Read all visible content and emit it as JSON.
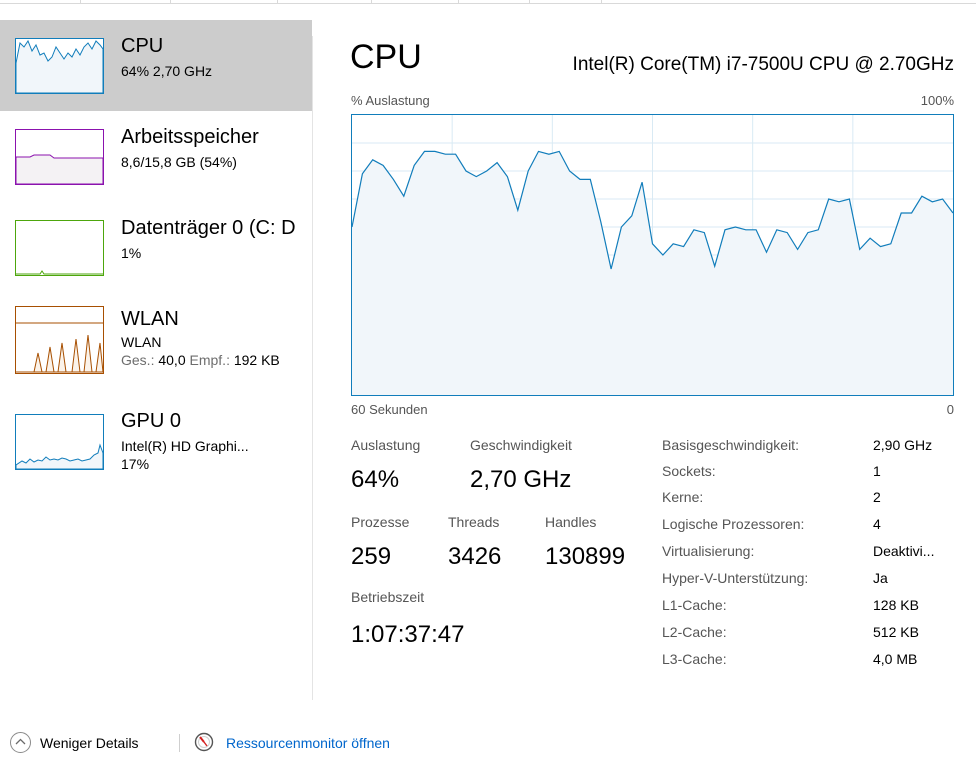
{
  "colors": {
    "cpu_accent": "#117dbb",
    "cpu_fill": "#f1f6fa",
    "memory_accent": "#8b12ae",
    "disk_accent": "#4da60c",
    "wlan_accent": "#a74f01",
    "gpu_accent": "#117dbb",
    "selected_bg": "#cccccc",
    "link": "#0066cc"
  },
  "sidebar": {
    "items": [
      {
        "title": "CPU",
        "sub1": "64% 2,70 GHz"
      },
      {
        "title": "Arbeitsspeicher",
        "sub1": "8,6/15,8 GB (54%)"
      },
      {
        "title": "Datenträger 0 (C: D",
        "sub1": "1%"
      },
      {
        "title": "WLAN",
        "sub1": "WLAN",
        "sub2_a": "Ges.: ",
        "sub2_b": "40,0",
        "sub2_c": " Empf.: ",
        "sub2_d": "192 KB"
      },
      {
        "title": "GPU 0",
        "sub1": "Intel(R) HD Graphi...",
        "sub2": "17%"
      }
    ]
  },
  "main": {
    "title": "CPU",
    "model": "Intel(R) Core(TM) i7-7500U CPU @ 2.70GHz",
    "graph": {
      "top_left": "% Auslastung",
      "top_right": "100%",
      "bottom_left": "60 Sekunden",
      "bottom_right": "0"
    },
    "stats": {
      "auslastung_label": "Auslastung",
      "auslastung_value": "64%",
      "geschw_label": "Geschwindigkeit",
      "geschw_value": "2,70 GHz",
      "prozesse_label": "Prozesse",
      "prozesse_value": "259",
      "threads_label": "Threads",
      "threads_value": "3426",
      "handles_label": "Handles",
      "handles_value": "130899",
      "betriebszeit_label": "Betriebszeit",
      "betriebszeit_value": "1:07:37:47"
    },
    "details": [
      {
        "label": "Basisgeschwindigkeit:",
        "value": "2,90 GHz"
      },
      {
        "label": "Sockets:",
        "value": "1"
      },
      {
        "label": "Kerne:",
        "value": "2"
      },
      {
        "label": "Logische Prozessoren:",
        "value": "4"
      },
      {
        "label": "Virtualisierung:",
        "value": "Deaktivi..."
      },
      {
        "label": "Hyper-V-Unterstützung:",
        "value": "Ja"
      },
      {
        "label": "L1-Cache:",
        "value": "128 KB"
      },
      {
        "label": "L2-Cache:",
        "value": "512 KB"
      },
      {
        "label": "L3-Cache:",
        "value": "4,0 MB"
      }
    ]
  },
  "chart_data": {
    "type": "area",
    "ylim": [
      0,
      100
    ],
    "values": [
      60,
      79,
      84,
      82,
      77,
      71,
      82,
      87,
      87,
      86,
      86,
      80,
      78,
      80,
      83,
      78,
      66,
      80,
      87,
      86,
      87,
      80,
      77,
      77,
      62,
      45,
      60,
      64,
      76,
      54,
      50,
      54,
      53,
      59,
      58,
      46,
      59,
      60,
      59,
      59,
      51,
      59,
      58,
      52,
      58,
      59,
      70,
      69,
      70,
      52,
      56,
      53,
      54,
      65,
      65,
      71,
      69,
      70,
      65
    ]
  },
  "footer": {
    "less_details": "Weniger Details",
    "resource_monitor": "Ressourcenmonitor öffnen"
  }
}
